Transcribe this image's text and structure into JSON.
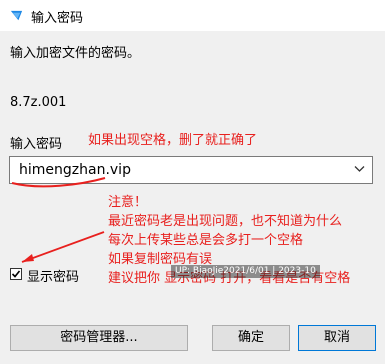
{
  "window": {
    "title": "输入密码",
    "icon": "app-icon"
  },
  "prompt": "输入加密文件的密码。",
  "filename": "8.7z.001",
  "password": {
    "label": "输入密码",
    "value": "himengzhan.vip"
  },
  "show_password": {
    "label": "显示密码",
    "checked": true
  },
  "buttons": {
    "manager": "密码管理器...",
    "ok": "确定",
    "cancel": "取消"
  },
  "annotations": {
    "top": "如果出现空格，删了就正确了",
    "note": [
      "注意！",
      "最近密码老是出现问题，也不知道为什么",
      "每次上传某些总是会多打一个空格",
      "如果复制密码有误",
      "建议把你 显示密码 打开，看看是否有空格"
    ],
    "color": "#e8201e"
  },
  "watermark": "UP: BiaoJie2021/6/01 | 2023-10"
}
